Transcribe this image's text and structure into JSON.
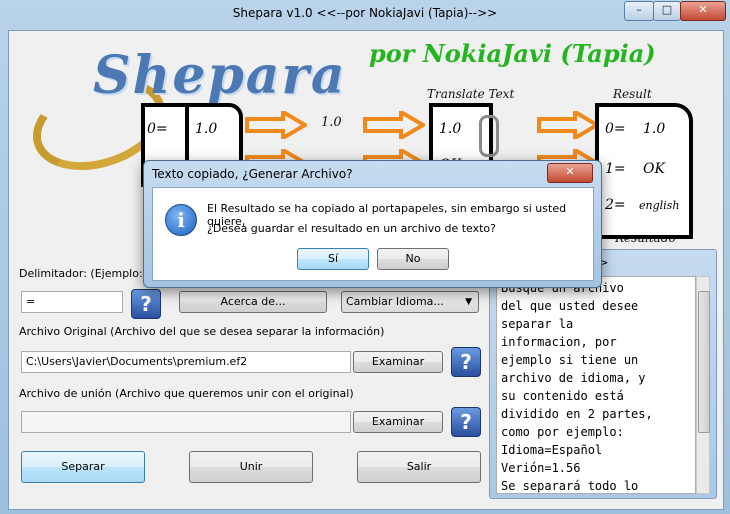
{
  "window": {
    "title": "Shepara v1.0 <<--por NokiaJavi (Tapia)-->>",
    "controls": {
      "minimize": "–",
      "maximize": "□",
      "close": "✕"
    }
  },
  "banner": {
    "logo_text": "Shepara",
    "byline": "por NokiaJavi (Tapia)",
    "translate_caption": "Translate Text",
    "result_caption": "Result",
    "result_label_bottom": "Resultado",
    "doc1_lines": [
      "0=",
      "1.0"
    ],
    "doc_small": "1.0",
    "doc_translate": "1.0",
    "doc_translate2": "OK",
    "doc_result_lines": [
      "0=",
      "1.0",
      "1=",
      "OK",
      "2=",
      "english"
    ],
    "arrow_color": "#f08a1c"
  },
  "form": {
    "delimiter_label": "Delimitador: (Ejemplo: =,",
    "delimiter_value": "=",
    "about_button": "Acerca de...",
    "language_select": "Cambiar Idioma...",
    "original_label": "Archivo Original (Archivo del que se desea separar la información)",
    "original_value": "C:\\Users\\Javier\\Documents\\premium.ef2",
    "browse1": "Examinar",
    "union_label": "Archivo de unión (Archivo que queremos unir con el original)",
    "union_value": "",
    "browse2": "Examinar",
    "split_button": "Separar",
    "join_button": "Unir",
    "exit_button": "Salir",
    "help_glyph": "?"
  },
  "panel": {
    "heading": ">>",
    "text": "Busque un archivo\ndel que usted desee\nseparar la\ninformacion, por\nejemplo si tiene un\narchivo de idioma, y\nsu contenido está\ndividido en 2 partes,\ncomo por ejemplo:\nIdioma=Español\nVerión=1.56\nSe separará todo lo"
  },
  "dialog": {
    "title": "Texto copiado, ¿Generar Archivo?",
    "close": "✕",
    "icon": "i",
    "line1": "El Resultado se ha copiado al portapapeles, sin embargo si usted quiere,",
    "line2": "¿Desea guardar el resultado en un archivo de texto?",
    "yes": "Sí",
    "no": "No"
  }
}
